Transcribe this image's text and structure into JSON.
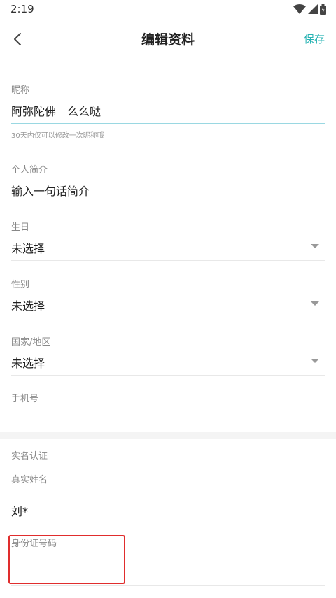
{
  "status_bar": {
    "time": "2:19",
    "icons": [
      "wifi-icon",
      "signal-icon",
      "battery-icon"
    ]
  },
  "nav": {
    "back_icon": "chevron-left-icon",
    "title": "编辑资料",
    "save_label": "保存"
  },
  "form": {
    "nickname": {
      "label": "昵称",
      "value": "阿弥陀佛　么么哒",
      "hint": "30天内仅可以修改一次昵称哦"
    },
    "bio": {
      "label": "个人简介",
      "placeholder": "输入一句话简介"
    },
    "birthday": {
      "label": "生日",
      "value": "未选择"
    },
    "gender": {
      "label": "性别",
      "value": "未选择"
    },
    "region": {
      "label": "国家/地区",
      "value": "未选择"
    },
    "phone": {
      "label": "手机号",
      "value": ""
    },
    "verification": {
      "section_label": "实名认证",
      "real_name": {
        "label": "真实姓名",
        "value": "刘*"
      },
      "id_number": {
        "label": "身份证号码",
        "value": ""
      }
    }
  },
  "colors": {
    "accent": "#2ab4b4",
    "highlight_box": "#e02d2d"
  }
}
